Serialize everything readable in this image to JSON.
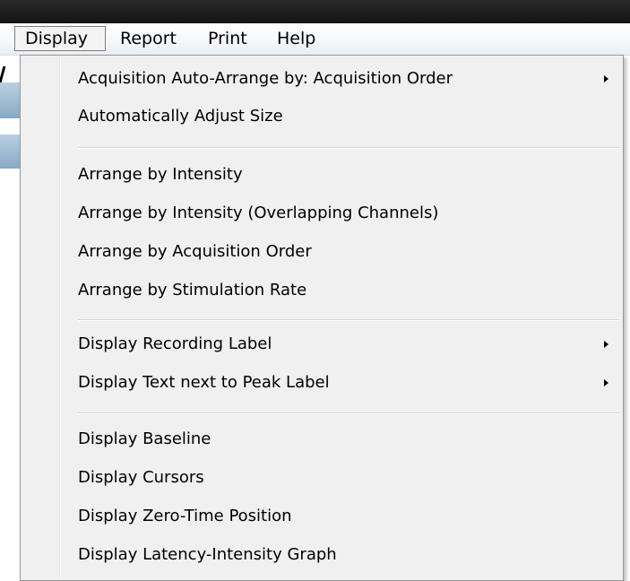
{
  "menubar": {
    "items": [
      {
        "label": "Display",
        "active": true
      },
      {
        "label": "Report",
        "active": false
      },
      {
        "label": "Print",
        "active": false
      },
      {
        "label": "Help",
        "active": false
      }
    ]
  },
  "dropdown": {
    "groups": [
      [
        {
          "label": "Acquisition Auto-Arrange by: Acquisition Order",
          "submenu": true
        },
        {
          "label": "Automatically Adjust Size",
          "submenu": false
        }
      ],
      [
        {
          "label": "Arrange by Intensity",
          "submenu": false
        },
        {
          "label": "Arrange by Intensity (Overlapping Channels)",
          "submenu": false
        },
        {
          "label": "Arrange by Acquisition Order",
          "submenu": false
        },
        {
          "label": "Arrange by Stimulation Rate",
          "submenu": false
        }
      ],
      [
        {
          "label": "Display Recording Label",
          "submenu": true
        },
        {
          "label": "Display Text next to Peak Label",
          "submenu": true
        }
      ],
      [
        {
          "label": "Display Baseline",
          "submenu": false
        },
        {
          "label": "Display Cursors",
          "submenu": false
        },
        {
          "label": "Display Zero-Time Position",
          "submenu": false
        },
        {
          "label": "Display Latency-Intensity Graph",
          "submenu": false
        }
      ]
    ]
  },
  "icons": {
    "submenu_arrow": "chevron-right-icon"
  }
}
